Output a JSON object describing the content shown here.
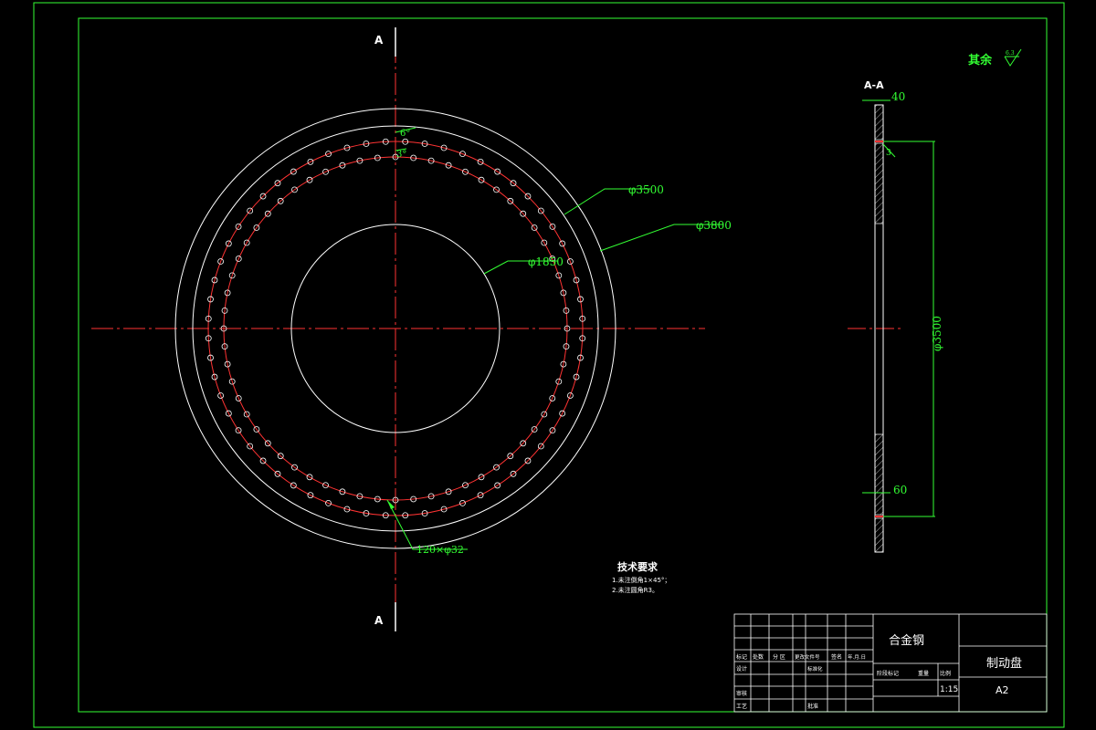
{
  "drawing": {
    "section_marker": "A",
    "section_title": "A-A",
    "surface_finish_note": "其余",
    "surface_finish_value": "6.3",
    "dimensions": {
      "outer_diameter": "φ3800",
      "hole_circle_diameter": "φ3500",
      "inner_diameter": "φ1850",
      "hole_spec": "120×φ32",
      "angle_outer": "6°",
      "angle_inner": "3°",
      "section_thickness_top": "40",
      "section_thickness_bottom": "60",
      "section_height": "φ3500",
      "chamfer_callout": "3"
    },
    "tech_requirements": {
      "title": "技术要求",
      "items": [
        "1.未注倒角1×45°；",
        "2.未注圆角R3。"
      ]
    },
    "title_block": {
      "material": "合金钢",
      "part_name": "制动盘",
      "scale": "1:15",
      "sheet_size": "A2",
      "header_cells": [
        "标记",
        "处数",
        "分  区",
        "更改文件号",
        "签名",
        "年.月.日"
      ],
      "row_labels": [
        "设计",
        "审核",
        "工艺"
      ],
      "mid_labels": [
        "标准化",
        "批准"
      ],
      "stage_labels": [
        "阶段标记",
        "重量",
        "比例"
      ]
    },
    "colors": {
      "frame": "#33ff33",
      "centerline": "#ff3333",
      "outline": "#ffffff",
      "dimension": "#33ff33"
    }
  }
}
